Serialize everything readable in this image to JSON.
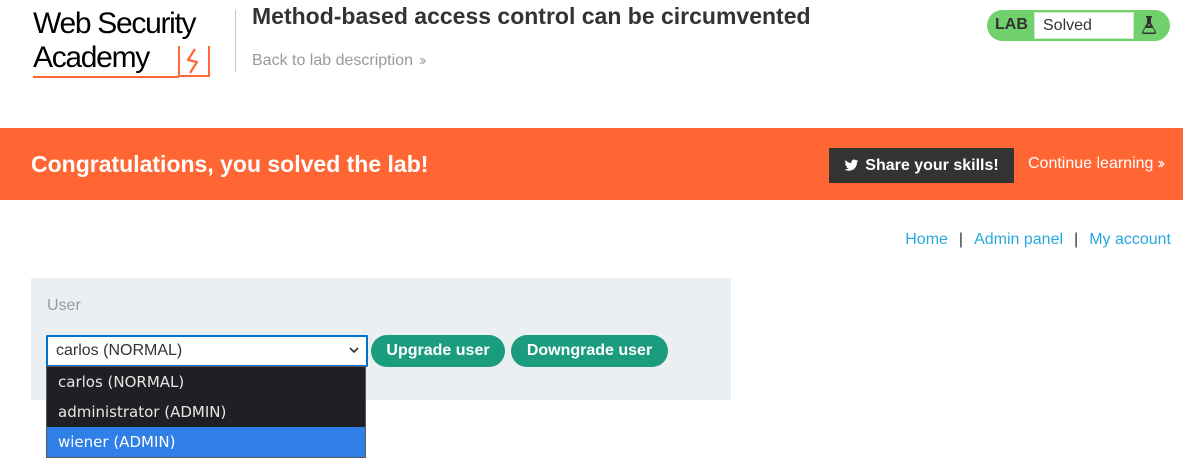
{
  "header": {
    "logo": {
      "line1": "Web Security",
      "line2": "Academy"
    },
    "lab_title": "Method-based access control can be circumvented",
    "back_link": "Back to lab description",
    "status": {
      "badge": "LAB",
      "value": "Solved",
      "icon": "flask-icon"
    }
  },
  "banner": {
    "message": "Congratulations, you solved the lab!",
    "share_button": "Share your skills!",
    "share_icon": "twitter-icon",
    "continue_link": "Continue learning"
  },
  "nav": {
    "home": "Home",
    "separator": "|",
    "admin_panel": "Admin panel",
    "my_account": "My account"
  },
  "admin_form": {
    "label": "User",
    "selected": "carlos (NORMAL)",
    "upgrade_button": "Upgrade user",
    "downgrade_button": "Downgrade user",
    "options": [
      {
        "label": "carlos (NORMAL)"
      },
      {
        "label": "administrator (ADMIN)"
      },
      {
        "label": "wiener (ADMIN)",
        "highlighted": true
      }
    ]
  },
  "colors": {
    "accent_orange": "#ff6633",
    "status_green": "#70d16d",
    "button_green": "#1c9c7e",
    "link_blue": "#29a8de",
    "highlight_blue": "#2f7fe6"
  }
}
